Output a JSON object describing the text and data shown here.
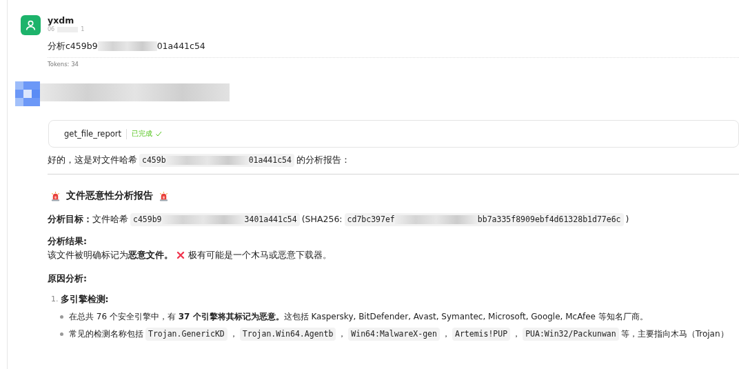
{
  "user_message": {
    "name": "yxdm",
    "time_parts": [
      "06",
      "1"
    ],
    "parts": [
      {
        "kind": "text",
        "text": "分析c459b9"
      },
      {
        "kind": "mask"
      },
      {
        "kind": "text",
        "text": "01a441c54"
      }
    ],
    "tokens": "Tokens: 34"
  },
  "assistant_message": {
    "tool_call": {
      "name": "get_file_report",
      "status": "已完成",
      "done": true
    },
    "intro": [
      {
        "kind": "text",
        "text": "好的，这是对文件哈希"
      },
      {
        "kind": "code",
        "head": "c459b",
        "tail": "01a441c54"
      },
      {
        "kind": "text",
        "text": "的分析报告："
      }
    ],
    "heading": "文件恶意性分析报告",
    "target": [
      {
        "kind": "label",
        "text": "分析目标："
      },
      {
        "kind": "text",
        "text": "文件哈希"
      },
      {
        "kind": "code",
        "head": "c459b9",
        "tail": "3401a441c54"
      },
      {
        "kind": "text",
        "text": "(SHA256:"
      },
      {
        "kind": "code",
        "head": "cd7bc397ef",
        "tail": "bb7a335f8909ebf4d61328b1d77e6c"
      },
      {
        "kind": "text",
        "text": ")"
      }
    ],
    "result_label": "分析结果:",
    "result": [
      {
        "kind": "text",
        "text": "该文件被明确标记为**恶意文件。**"
      },
      {
        "kind": "cross"
      },
      {
        "kind": "text",
        "text": "极有可能是一个木马或恶意下载器。"
      }
    ],
    "reason_label": "原因分析:",
    "list": [
      {
        "number": "1.",
        "title": "多引擎检测:",
        "bullets": [
          [
            {
              "kind": "text",
              "text": "在总共 76 个安全引擎中，有 **37 个引擎将其标记为恶意。**这包括 Kaspersky, BitDefender, Avast, Symantec, Microsoft, Google, McAfee 等知名厂商。"
            }
          ],
          [
            {
              "kind": "text",
              "text": "常见的检测名称包括"
            },
            {
              "kind": "code",
              "head": "Trojan.GenericKD"
            },
            {
              "kind": "text",
              "text": "，"
            },
            {
              "kind": "code",
              "head": "Trojan.Win64.Agentb"
            },
            {
              "kind": "text",
              "text": "，"
            },
            {
              "kind": "code",
              "head": "Win64:MalwareX-gen"
            },
            {
              "kind": "text",
              "text": "，"
            },
            {
              "kind": "code",
              "head": "Artemis!PUP"
            },
            {
              "kind": "text",
              "text": "，"
            },
            {
              "kind": "code",
              "head": "PUA:Win32/Packunwan"
            },
            {
              "kind": "text",
              "text": "等，主要指向木马（Trojan）"
            }
          ]
        ]
      }
    ]
  }
}
